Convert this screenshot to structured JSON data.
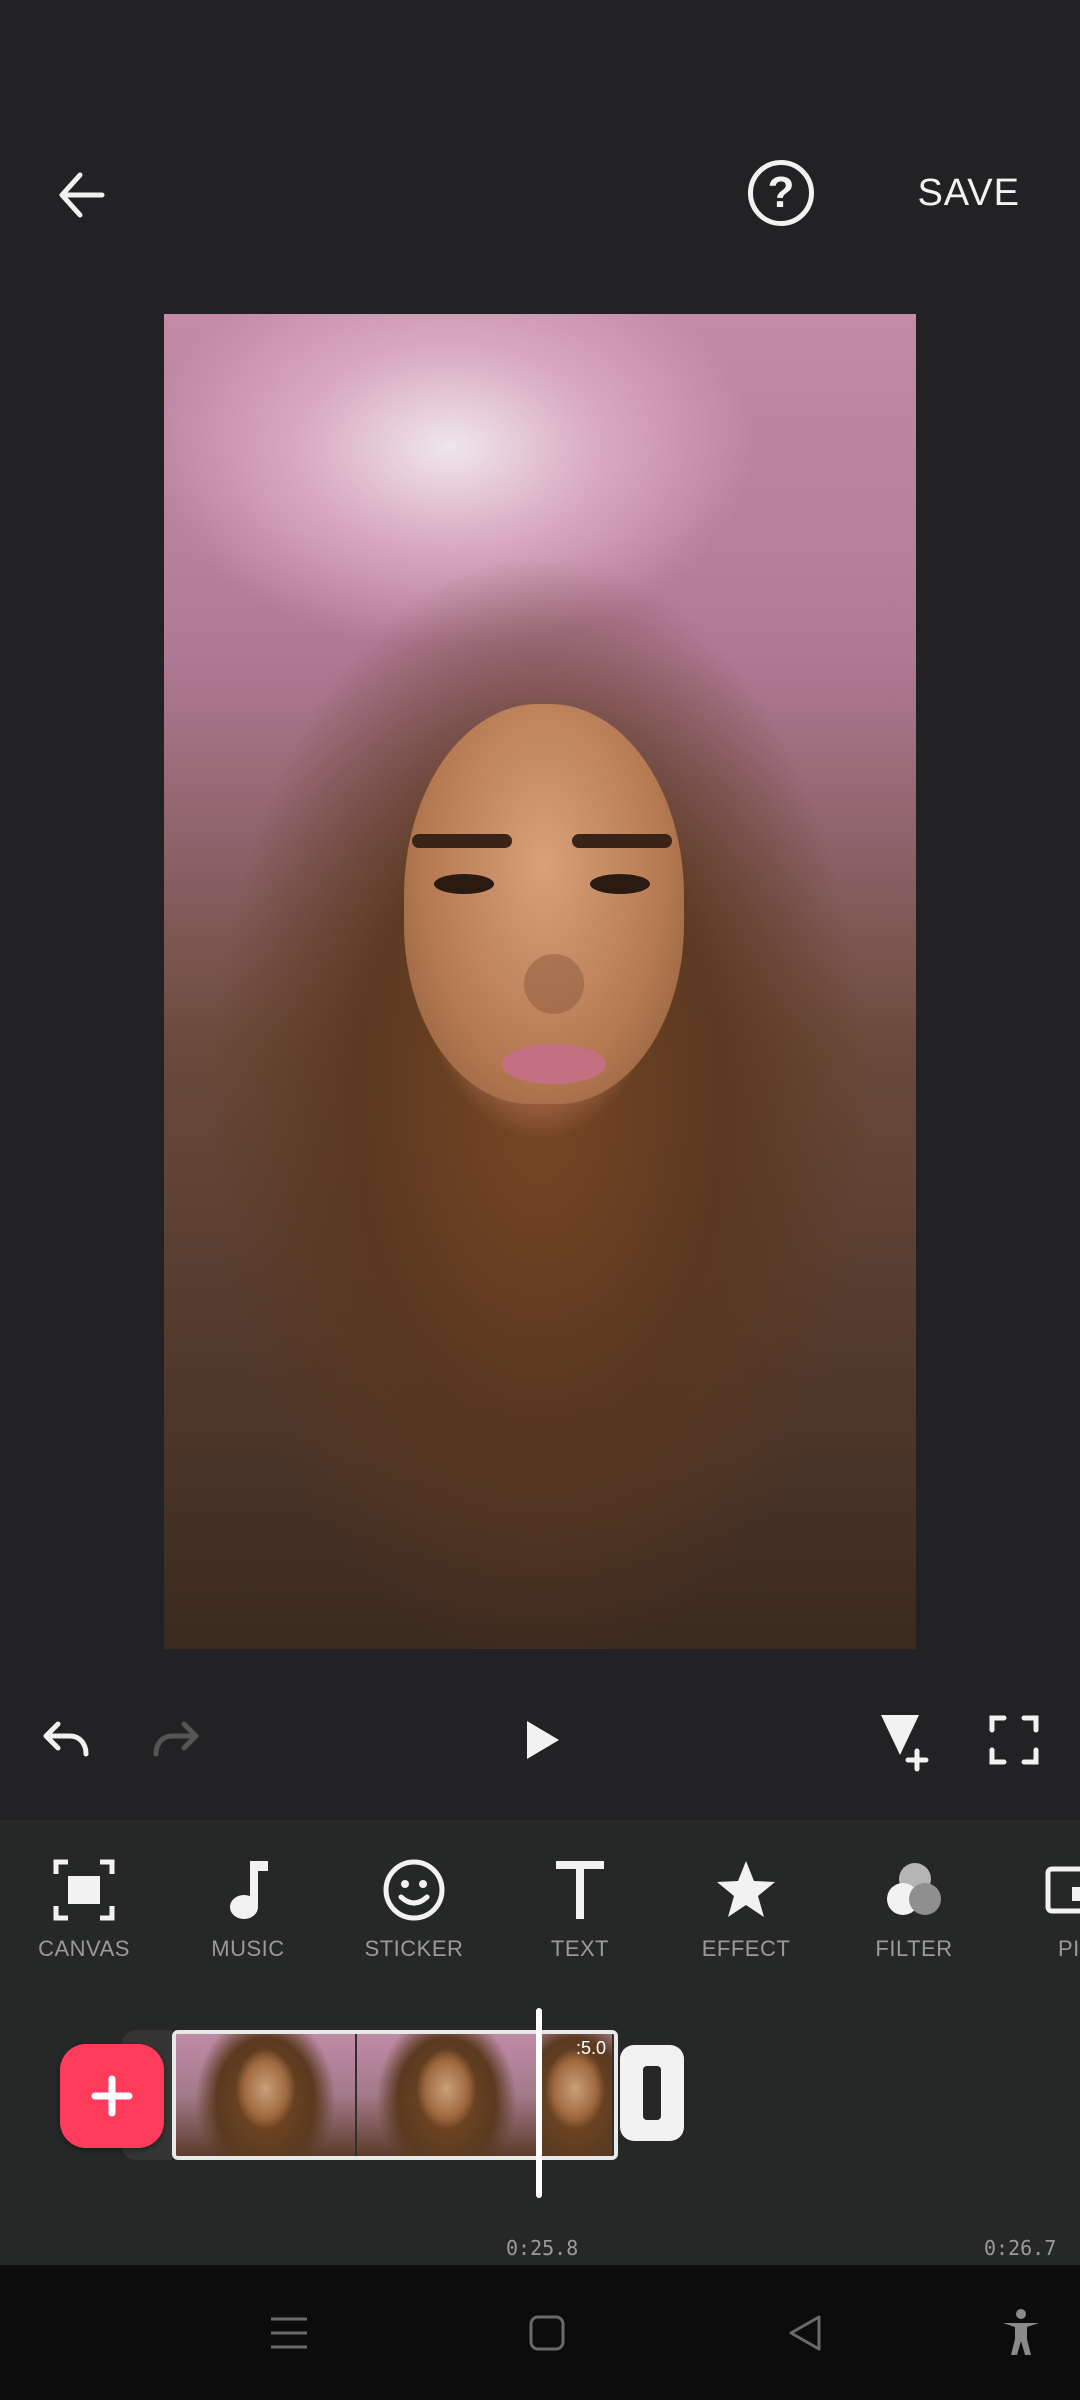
{
  "topbar": {
    "back_icon": "back-arrow-icon",
    "help_icon": "help-circle-icon",
    "save_label": "SAVE"
  },
  "preview": {
    "description_icon": "video-frame"
  },
  "playback": {
    "undo_icon": "undo-icon",
    "redo_icon": "redo-icon",
    "play_icon": "play-icon",
    "keyframe_icon": "keyframe-add-icon",
    "fullscreen_icon": "fullscreen-icon"
  },
  "tools": [
    {
      "label": "CANVAS",
      "icon": "canvas-icon"
    },
    {
      "label": "MUSIC",
      "icon": "music-note-icon"
    },
    {
      "label": "STICKER",
      "icon": "smiley-icon"
    },
    {
      "label": "TEXT",
      "icon": "text-t-icon"
    },
    {
      "label": "EFFECT",
      "icon": "star-icon"
    },
    {
      "label": "FILTER",
      "icon": "filter-circles-icon"
    },
    {
      "label": "PI",
      "icon": "pip-icon"
    }
  ],
  "timeline": {
    "clip_duration_label": ":5.0",
    "current_time": "0:25.8",
    "total_time": "0:26.7"
  },
  "colors": {
    "background": "#222224",
    "toolbar": "#262827",
    "accent": "#ff3b5c"
  }
}
